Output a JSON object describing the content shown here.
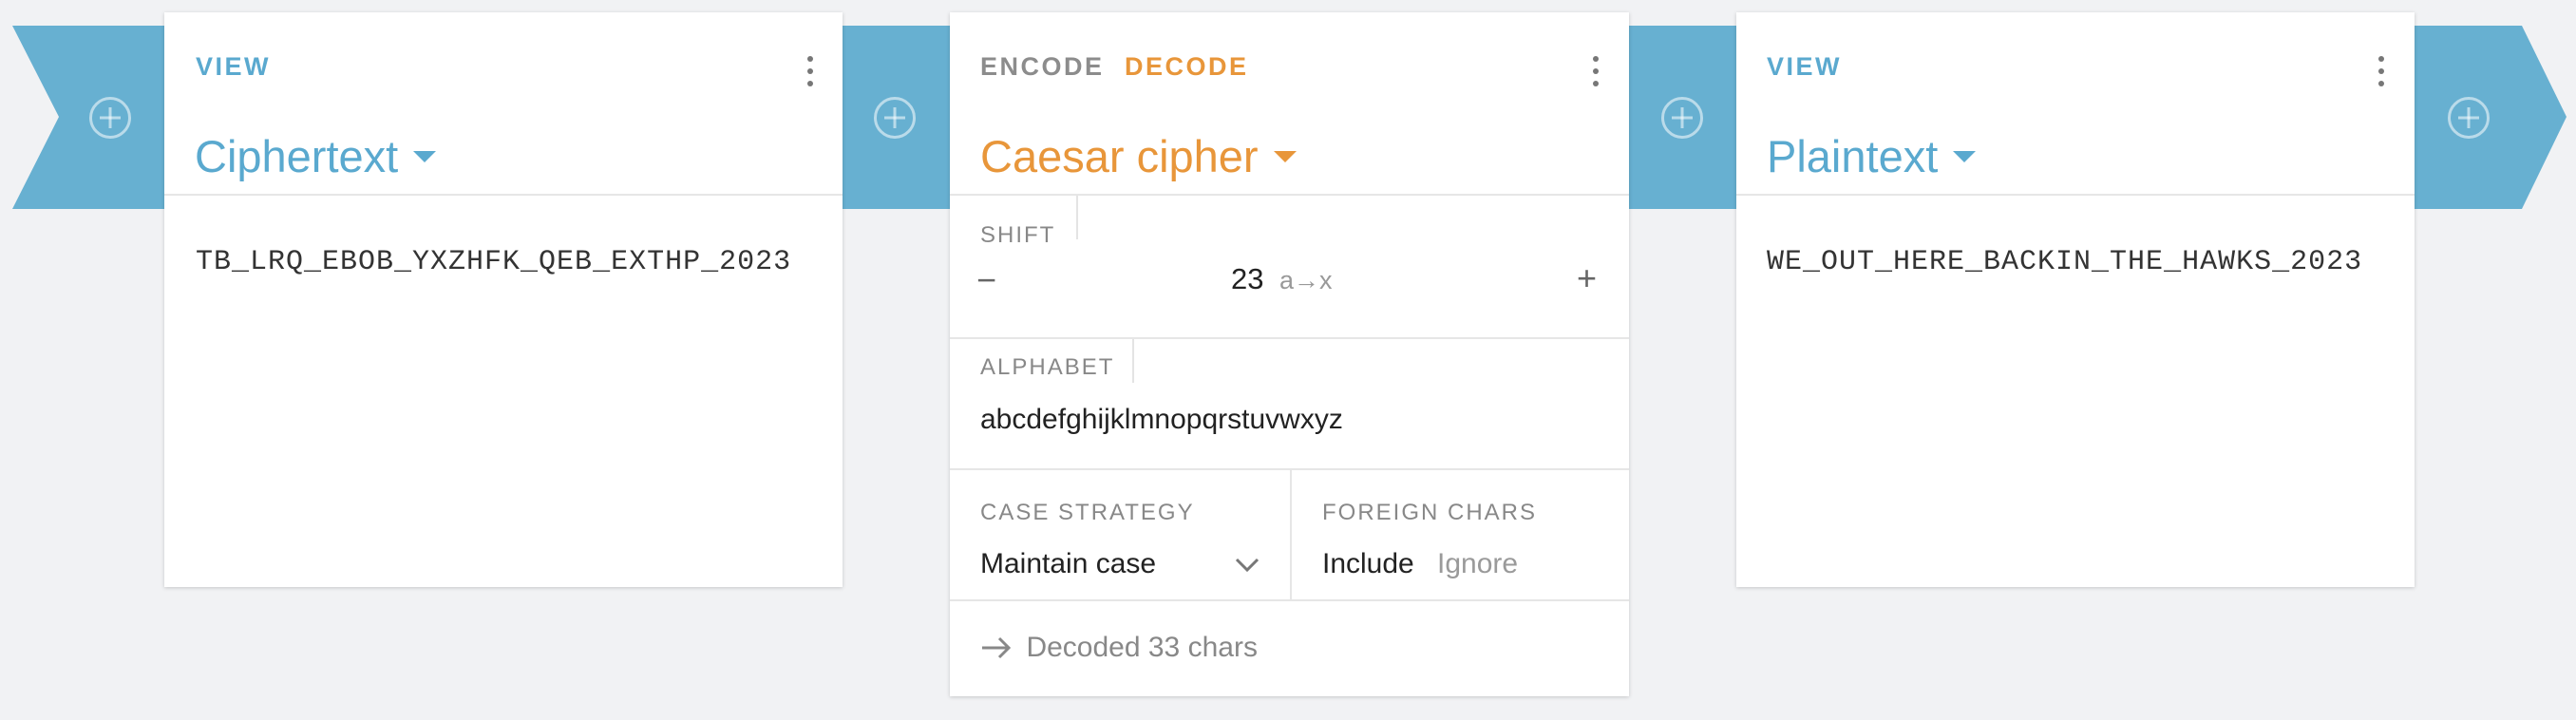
{
  "pipeline": {
    "view_card_left": {
      "mode": "VIEW",
      "title": "Ciphertext",
      "content": "TB_LRQ_EBOB_YXZHFK_QEB_EXTHP_2023"
    },
    "cipher_card": {
      "mode_encode": "ENCODE",
      "mode_decode": "DECODE",
      "title": "Caesar cipher",
      "shift": {
        "label": "SHIFT",
        "minus": "−",
        "value": "23",
        "mapping": "a→x",
        "plus": "+"
      },
      "alphabet": {
        "label": "ALPHABET",
        "value": "abcdefghijklmnopqrstuvwxyz"
      },
      "case_strategy": {
        "label": "CASE STRATEGY",
        "value": "Maintain case"
      },
      "foreign_chars": {
        "label": "FOREIGN CHARS",
        "option_include": "Include",
        "option_ignore": "Ignore"
      },
      "status": "Decoded 33 chars"
    },
    "view_card_right": {
      "mode": "VIEW",
      "title": "Plaintext",
      "content": "WE_OUT_HERE_BACKIN_THE_HAWKS_2023"
    }
  },
  "icons": {
    "add": "plus-circle-icon",
    "menu": "more-vertical-icon",
    "dropdown": "caret-down-icon",
    "select": "chevron-down-icon",
    "status": "arrow-right-icon"
  },
  "colors": {
    "pipe_blue": "#67b0d1",
    "view_blue": "#5aa9cf",
    "decode_orange": "#e8963a",
    "background": "#f1f2f4"
  }
}
